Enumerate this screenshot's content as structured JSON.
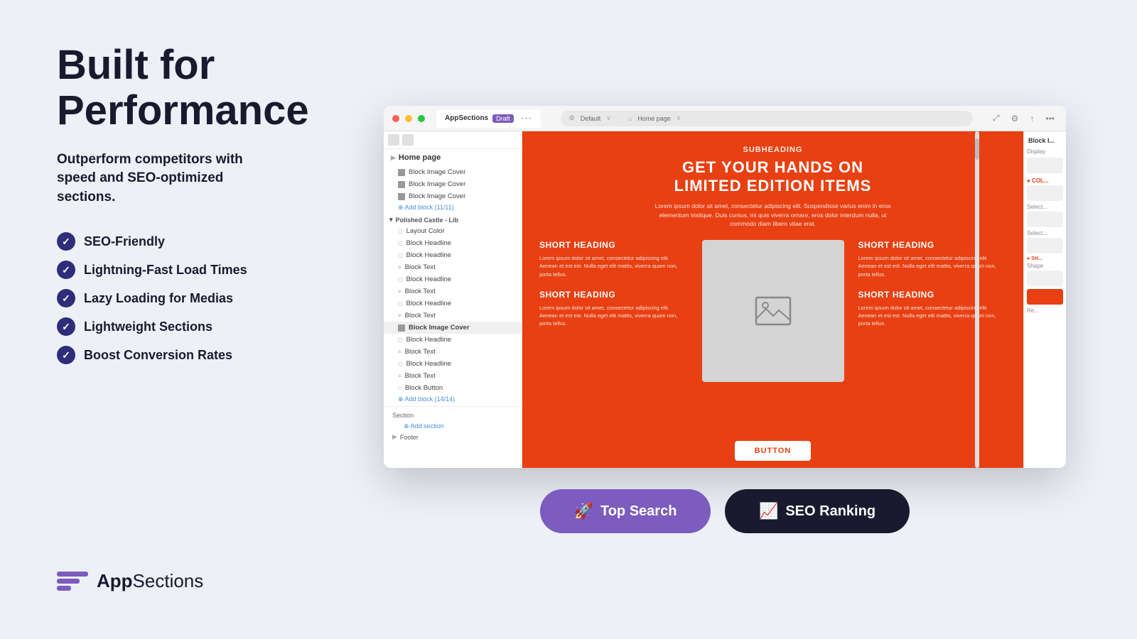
{
  "page": {
    "background": "#eef0f8"
  },
  "left": {
    "title_line1": "Built for",
    "title_line2": "Performance",
    "subtitle": "Outperform competitors with speed and SEO-optimized sections.",
    "features": [
      "SEO-Friendly",
      "Lightning-Fast Load Times",
      "Lazy Loading for Medias",
      "Lightweight Sections",
      "Boost Conversion Rates"
    ],
    "logo_text_bold": "App",
    "logo_text_light": "Sections"
  },
  "browser": {
    "tab_label": "AppSections",
    "tab_badge": "Draft",
    "url_default": "Default",
    "url_homepage": "Home page",
    "sidebar": {
      "page_title": "Home page",
      "items": [
        "Block Image Cover",
        "Block Image Cover",
        "Block Image Cover",
        "Add block (11/11)",
        "Polished Castle - Lib",
        "Layout Color",
        "Block Headline",
        "Block Headline",
        "Block Text",
        "Block Headline",
        "Block Text",
        "Block Headline",
        "Block Text",
        "Block Image Cover",
        "Block Headline",
        "Block Text",
        "Block Headline",
        "Block Text",
        "Block Button",
        "Add block (14/14)"
      ],
      "add_section": "Add section",
      "footer_label": "Footer",
      "footer_add": "Add section"
    },
    "canvas": {
      "subheading": "SUBHEADING",
      "main_heading_line1": "GET YOUR HANDS ON",
      "main_heading_line2": "LIMITED EDITION ITEMS",
      "description": "Lorem ipsum dolor sit amet, consectetur adipiscing elit. Suspendisse varius enim in eros elementum tristique. Duis cursus, mi quis viverra ornare, eros dolor interdum nulla, ut commodo diam libero vitae erat.",
      "short_heading_1": "SHORT HEADING",
      "short_heading_2": "SHORT HEADING",
      "short_heading_3": "SHORT HEADING",
      "short_heading_4": "SHORT HEADING",
      "card_text": "Lorem ipsum dolor sit amet, consectetur adipiscing elit. Aenean et est est. Nulla eget elit mattis, viverra quam non, porta tellus.",
      "button_label": "BUTTON"
    },
    "right_panel_title": "Block I..."
  },
  "buttons": {
    "top_search_label": "Top Search",
    "top_search_icon": "🚀",
    "seo_ranking_label": "SEO Ranking",
    "seo_ranking_icon": "📈"
  }
}
